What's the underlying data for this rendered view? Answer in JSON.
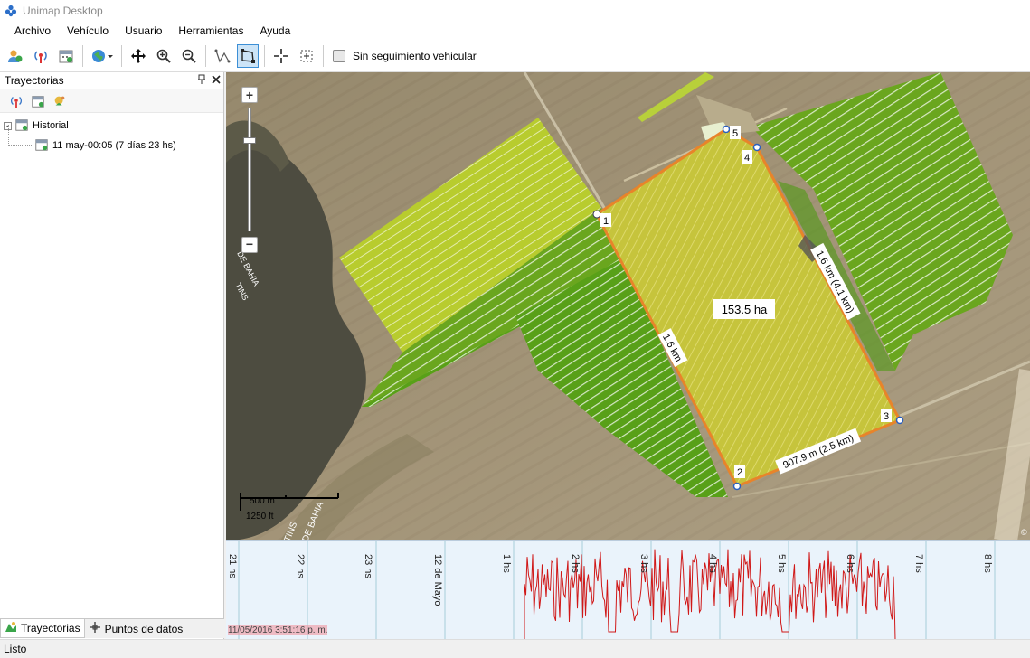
{
  "window": {
    "title": "Unimap Desktop"
  },
  "menu": [
    "Archivo",
    "Vehículo",
    "Usuario",
    "Herramientas",
    "Ayuda"
  ],
  "toolbar": {
    "tracking_label": "Sin seguimiento vehicular",
    "tracking_checked": false
  },
  "panel": {
    "title": "Trayectorias",
    "tree": [
      {
        "label": "Historial"
      },
      {
        "label": "11 may-00:05 (7 días 23 hs)"
      }
    ]
  },
  "bottom_tabs": [
    "Trayectorias",
    "Puntos de datos"
  ],
  "status": "Listo",
  "map": {
    "zoom_in": "+",
    "zoom_out": "−",
    "area_label": "153.5 ha",
    "measures": {
      "side_left": "1.6 km",
      "side_right": "1.6 km (4.1 km)",
      "side_bottom": "907.9 m (2.5 km)"
    },
    "vertices": [
      "1",
      "2",
      "3",
      "4",
      "5"
    ],
    "scale": {
      "metric": "500 m",
      "imperial": "1250 ft"
    },
    "road_labels": [
      "DE BAHIA",
      "TINS",
      "TINS",
      "DE BAHIA"
    ],
    "copyright": "©"
  },
  "timeline": {
    "labels": [
      "21 hs",
      "22 hs",
      "23 hs",
      "12 de Mayo",
      "1 hs",
      "2 hs",
      "3 hs",
      "4 hs",
      "5 hs",
      "6 hs",
      "7 hs",
      "8 hs"
    ],
    "date_text": "11/05/2016 3:51:16 p. m."
  }
}
